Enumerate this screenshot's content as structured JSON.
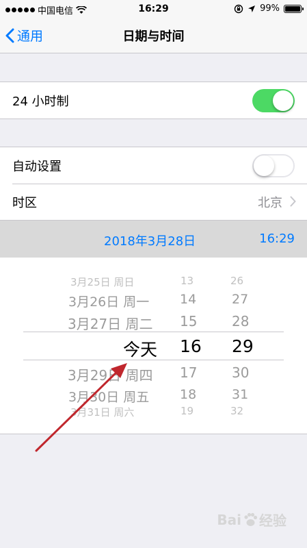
{
  "status_bar": {
    "carrier": "中国电信",
    "time": "16:29",
    "battery_text": "99%",
    "battery_level": 0.99,
    "icons": [
      "signal-dots-icon",
      "wifi-icon",
      "orientation-lock-icon",
      "location-arrow-icon",
      "battery-icon"
    ]
  },
  "nav": {
    "back_label": "通用",
    "title": "日期与时间"
  },
  "settings": {
    "hour24_label": "24 小时制",
    "hour24_on": true,
    "auto_set_label": "自动设置",
    "auto_set_on": false,
    "timezone_label": "时区",
    "timezone_value": "北京"
  },
  "current": {
    "date": "2018年3月28日",
    "time": "16:29"
  },
  "picker": {
    "dates": [
      "3月25日 周日",
      "3月26日 周一",
      "3月27日 周二",
      "今天",
      "3月29日 周四",
      "3月30日 周五",
      "3月31日 周六"
    ],
    "hours": [
      "13",
      "14",
      "15",
      "16",
      "17",
      "18",
      "19"
    ],
    "minutes": [
      "26",
      "27",
      "28",
      "29",
      "30",
      "31",
      "32"
    ],
    "selected_index": 3
  },
  "colors": {
    "accent": "#007aff",
    "toggle_on": "#4cd964",
    "annotation_arrow": "#c0272d"
  },
  "watermark": {
    "text_latin": "Bai",
    "text_cn": "经验"
  }
}
